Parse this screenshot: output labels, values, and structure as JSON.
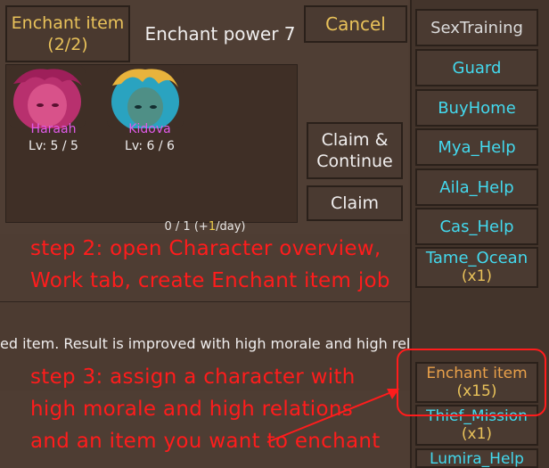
{
  "header": {
    "title_line1": "Enchant item",
    "title_line2": "(2/2)",
    "enchant_power": "Enchant power 7",
    "cancel_label": "Cancel"
  },
  "characters": [
    {
      "name": "Haraah",
      "level": "Lv: 5 / 5",
      "name_color": "#e05ae8"
    },
    {
      "name": "Kidova",
      "level": "Lv: 6 / 6",
      "name_color": "#e05ae8"
    }
  ],
  "actions": {
    "claim_continue": "Claim & Continue",
    "claim": "Claim"
  },
  "progress": {
    "prefix": "0 / 1 (+",
    "highlight": "1",
    "suffix": "/day)"
  },
  "description": "ed item. Result is improved with high morale and high relation to MC",
  "sidebar": {
    "items": [
      {
        "label": "SexTraining",
        "count": ""
      },
      {
        "label": "Guard",
        "count": ""
      },
      {
        "label": "BuyHome",
        "count": ""
      },
      {
        "label": "Mya_Help",
        "count": ""
      },
      {
        "label": "Aila_Help",
        "count": ""
      },
      {
        "label": "Cas_Help",
        "count": ""
      },
      {
        "label": "Tame_Ocean",
        "count": "(x1)"
      },
      {
        "label": "Enchant item",
        "count": "(x15)"
      },
      {
        "label": "Thief_Mission",
        "count": "(x1)"
      },
      {
        "label": "Lumira_Help",
        "count": ""
      }
    ]
  },
  "annotations": {
    "step2_line1": "step 2: open Character overview,",
    "step2_line2": "Work tab, create Enchant item job",
    "step3_line1": "step 3: assign a character with",
    "step3_line2": "high morale and high relations",
    "step3_line3": "and an item you want to enchant"
  },
  "colors": {
    "panel": "#4b3a30",
    "sidebar_text": "#43d9ee",
    "gold": "#e9c25a",
    "annotation": "#ff1c1c"
  }
}
